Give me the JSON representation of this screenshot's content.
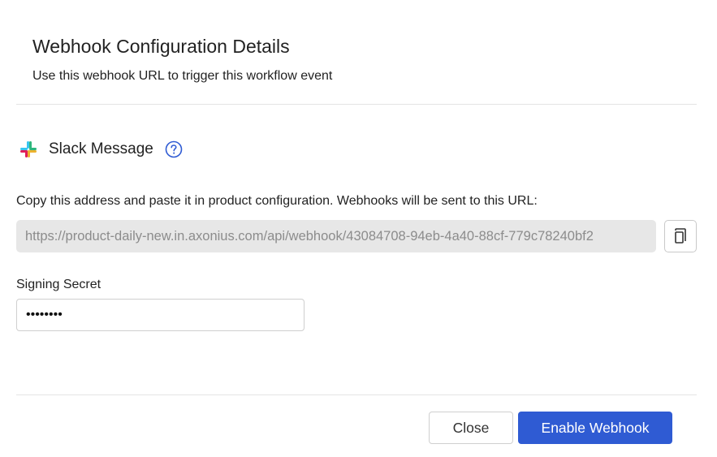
{
  "dialog": {
    "title": "Webhook Configuration Details",
    "subtitle": "Use this webhook URL to trigger this workflow event"
  },
  "integration": {
    "name": "Slack Message",
    "logo_icon": "slack-logo-icon",
    "help_icon": "question-circle-icon"
  },
  "webhook_url": {
    "label": "Copy this address and paste it in product configuration. Webhooks will be sent to this URL:",
    "value": "https://product-daily-new.in.axonius.com/api/webhook/43084708-94eb-4a40-88cf-779c78240bf2",
    "copy_icon": "copy-icon"
  },
  "signing_secret": {
    "label": "Signing Secret",
    "value": "••••••••"
  },
  "footer": {
    "close_label": "Close",
    "enable_label": "Enable Webhook"
  },
  "colors": {
    "primary": "#2f5bd3",
    "help_icon": "#2f5bd3",
    "url_field_bg": "#e7e7e7",
    "slack_green": "#2EB67D",
    "slack_blue": "#36C5F0",
    "slack_yellow": "#ECB22E",
    "slack_red": "#E01E5A"
  }
}
